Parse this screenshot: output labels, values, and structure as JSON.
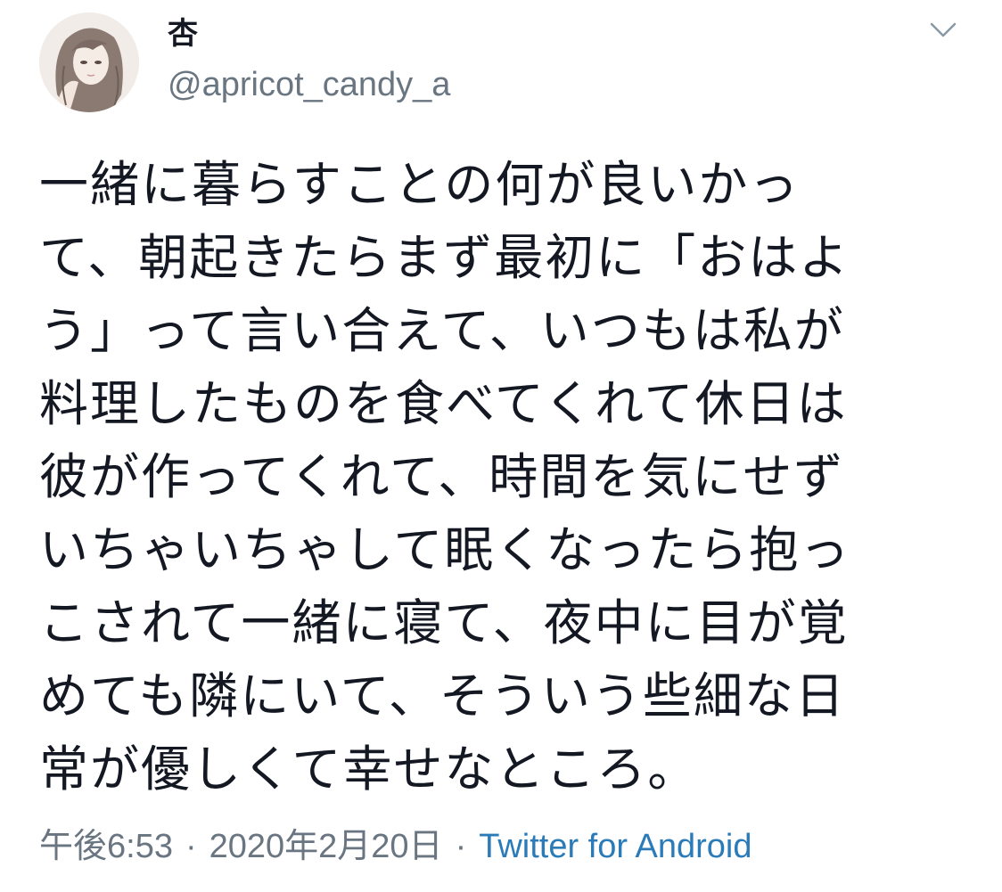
{
  "user": {
    "display_name": "杏",
    "handle": "@apricot_candy_a",
    "avatar_icon": "profile-avatar-illustration"
  },
  "menu": {
    "icon": "chevron-down-icon"
  },
  "tweet": {
    "lines": [
      "一緒に暮らすことの何が良いかっ",
      "て、朝起きたらまず最初に「おはよ",
      "う」って言い合えて、いつもは私が",
      "料理したものを食べてくれて休日は",
      "彼が作ってくれて、時間を気にせず",
      "いちゃいちゃして眠くなったら抱っ",
      "こされて一緒に寝て、夜中に目が覚",
      "めても隣にいて、そういう些細な日",
      "常が優しくて幸せなところ。"
    ]
  },
  "meta": {
    "time": "午後6:53",
    "separator": "·",
    "date": "2020年2月20日",
    "source": "Twitter for Android"
  },
  "colors": {
    "text": "#141823",
    "secondary": "#697580",
    "link": "#2b7bb9",
    "background": "#ffffff"
  }
}
